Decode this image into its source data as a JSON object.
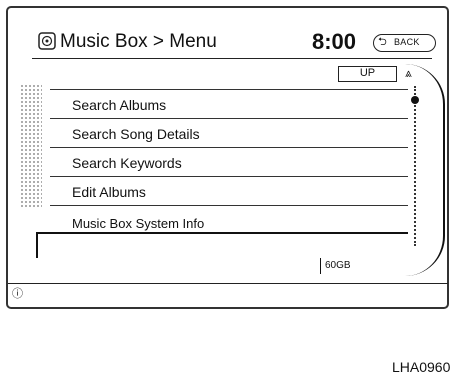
{
  "header": {
    "title": "Music Box > Menu",
    "clock": "8:00",
    "back_label": "BACK"
  },
  "scroll": {
    "up_label": "UP"
  },
  "menu": {
    "items": [
      {
        "label": "Search Albums"
      },
      {
        "label": "Search Song Details"
      },
      {
        "label": "Search Keywords"
      },
      {
        "label": "Edit Albums"
      },
      {
        "label": "Music Box System Info"
      }
    ]
  },
  "status": {
    "capacity": "60GB"
  },
  "icons": {
    "app": "music-box-icon",
    "back": "back-arrow-icon",
    "scroll_up": "double-chevron-up-icon",
    "footer": "info-icon"
  },
  "figure_code": "LHA0960"
}
